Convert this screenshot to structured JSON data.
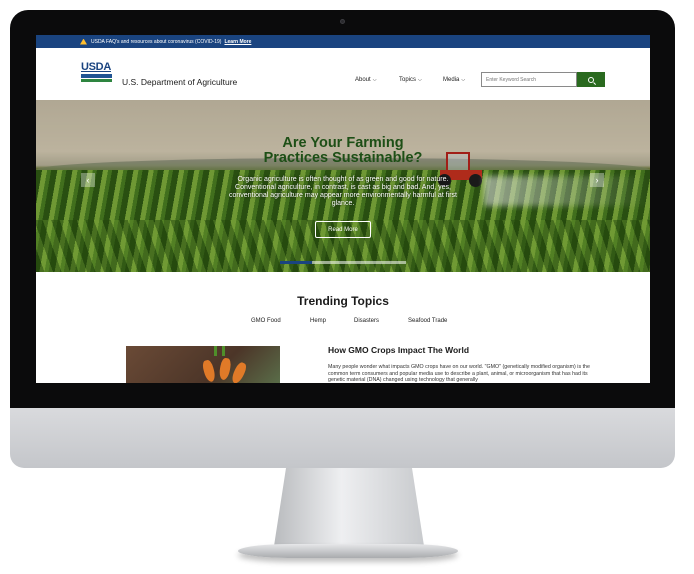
{
  "alert": {
    "message": "USDA FAQ's and resources about coronavirus (COVID-19)",
    "link": "Learn More"
  },
  "header": {
    "logo_text": "USDA",
    "agency": "U.S. Department of Agriculture",
    "nav": [
      "About",
      "Topics",
      "Media"
    ],
    "search_placeholder": "Enter Keyword Search"
  },
  "hero": {
    "title_line1": "Are Your Farming",
    "title_line2": "Practices Sustainable?",
    "text": "Organic agriculture is often thought of as green and good for nature. Conventional agriculture, in contrast, is cast as big and bad. And, yes, conventional agriculture may appear more environmentally harmful at first glance.",
    "button": "Read More",
    "prev": "‹",
    "next": "›",
    "slide_count": 4,
    "active_slide": 1
  },
  "trending": {
    "title": "Trending Topics",
    "topics": [
      "GMO Food",
      "Hemp",
      "Disasters",
      "Seafood Trade"
    ]
  },
  "article": {
    "title": "How GMO Crops Impact The World",
    "body": "Many people wonder what impacts GMO crops have on our world. \"GMO\" (genetically modified organism) is the common term consumers and popular media use to describe a plant, animal, or microorganism that has had its genetic material (DNA) changed using technology that generally"
  },
  "colors": {
    "alert_bg": "#1a4480",
    "search_button": "#2a6a1f",
    "hero_title": "#1d4f16"
  }
}
